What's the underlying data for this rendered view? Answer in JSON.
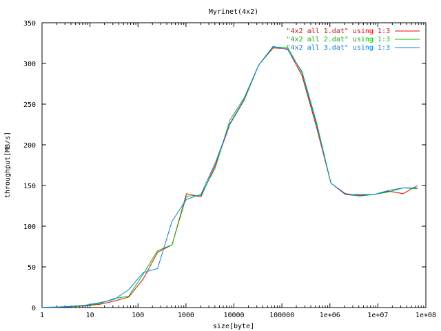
{
  "chart_data": {
    "type": "line",
    "title": "Myrinet(4x2)",
    "xlabel": "size[byte]",
    "ylabel": "throughput[MB/s]",
    "x_scale": "log",
    "xlim": [
      1,
      100000000
    ],
    "ylim": [
      0,
      350
    ],
    "grid": false,
    "legend_position": "top-right",
    "x_ticks": [
      1,
      10,
      100,
      1000,
      10000,
      100000,
      1000000,
      10000000,
      100000000
    ],
    "x_tick_labels": [
      "1",
      "10",
      "100",
      "1000",
      "10000",
      "100000",
      "1e+06",
      "1e+07",
      "1e+08"
    ],
    "y_ticks": [
      0,
      50,
      100,
      150,
      200,
      250,
      300,
      350
    ],
    "y_tick_labels": [
      "0",
      "50",
      "100",
      "150",
      "200",
      "250",
      "300",
      "350"
    ],
    "x": [
      1,
      2,
      4,
      8,
      16,
      32,
      64,
      128,
      256,
      512,
      1024,
      2048,
      4096,
      8192,
      16384,
      32768,
      65536,
      131072,
      262144,
      524288,
      1048576,
      2097152,
      4194304,
      8388608,
      16777216,
      33554432,
      67108864
    ],
    "series": [
      {
        "name": "\"4x2 all 1.dat\" using 1:3",
        "color": "#ff0000",
        "values": [
          0.2,
          0.5,
          1,
          2,
          4,
          8,
          13,
          35,
          68,
          77,
          140,
          136,
          175,
          225,
          255,
          298,
          319,
          318,
          285,
          222,
          153,
          140,
          138,
          139,
          143,
          140,
          150
        ]
      },
      {
        "name": "\"4x2 all 2.dat\" using 1:3",
        "color": "#00c000",
        "values": [
          0.3,
          0.6,
          1.2,
          2.5,
          5,
          11,
          14,
          41,
          70,
          77,
          137,
          138,
          172,
          230,
          258,
          298,
          320,
          320,
          288,
          225,
          153,
          139,
          139,
          139,
          142,
          147,
          146
        ]
      },
      {
        "name": "\"4x2 all 3.dat\" using 1:3",
        "color": "#0080ff",
        "values": [
          0.3,
          0.7,
          1.5,
          3,
          6,
          10,
          22,
          43,
          48,
          106,
          133,
          139,
          178,
          226,
          256,
          298,
          321,
          317,
          290,
          228,
          153,
          139,
          137,
          139,
          144,
          147,
          147
        ]
      }
    ]
  }
}
